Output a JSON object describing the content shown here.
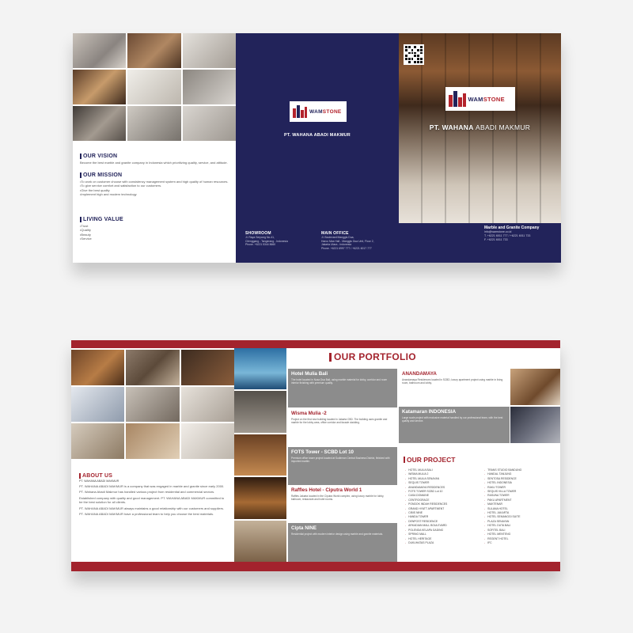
{
  "top_spread": {
    "left_panel": {
      "vision": {
        "heading": "OUR VISION",
        "text": "Become the best marble and granite company in Indonesia which prioritizing quality, service, and attitude."
      },
      "mission": {
        "heading": "OUR MISSION",
        "items": [
          "•To work on customer choose with consistency management system and high quality of human resources.",
          "•To give service comfort and satisfaction to our customers.",
          "•Give the best quality",
          "•Implement high and modern technology"
        ]
      },
      "values": {
        "heading": "LIVING VALUE",
        "items": [
          "•Trust",
          "•Quality",
          "•Beauty",
          "•Service"
        ]
      }
    },
    "middle_panel": {
      "logo_wam": "WAM",
      "logo_stone": "STONE",
      "company": "PT. WAHANA ABADI MAKMUR",
      "showroom": {
        "title": "SHOWROOM",
        "lines": [
          "Jl. Raya Serpong No.41,",
          "Cilenggang - Tangerang - Indonesia",
          "Phone. +6221 5344 8660"
        ]
      },
      "main_office": {
        "title": "MAIN OFFICE",
        "lines": [
          "Jl. Boulevard Manggis Dua,",
          "Harco Mas Hall - Manggis Dua Unit, Floor 2,",
          "Jakarta Utara - Indonesia",
          "Phone. +6221 6997 777 / +6221 6017 777"
        ]
      }
    },
    "cover": {
      "logo_wam": "WAM",
      "logo_stone": "STONE",
      "company_prefix": "PT. WAHANA ",
      "company_suffix": "ABADI MAKMUR",
      "tagline": "Marble and Granite Company",
      "contacts": [
        "info@wamstone.co.id",
        "T. +6221 6011 777 / +6221 6011 733",
        "F. +6221 6011 733"
      ]
    }
  },
  "bottom_spread": {
    "about": {
      "heading": "ABOUT US",
      "subheading": "PT. WAHANA ABADI MAKMUR",
      "paragraphs": [
        "PT. WAHANA ABADI MAKMUR is a company that was engaged in marble and granite since early 2000.",
        "PT. Wahana Abadi Makmur has handled various project from residential and commercial sectors.",
        "Established company with quality and good management. PT. WAHANA ABADI MAKMUR committed to be the best solution for all clients.",
        "PT. WAHANA ABADI MAKMUR always maintains a good relationship with our customers and suppliers.",
        "PT. WAHANA ABADI MAKMUR have a professional team to help you choose the best materials."
      ]
    },
    "portfolio_title": "OUR PORTFOLIO",
    "portfolio_cards": [
      {
        "title": "Hotel Mulia Bali",
        "text": "The hotel located in Nusa Dua Bali, using marble material for lobby, corridor and room interior finishing with premium quality."
      },
      {
        "title": "Wisma Mulia -2",
        "text": "Project on the first new building located in Jakarta CBD. The building uses granite and marble for the lobby area, office corridor and facade cladding."
      },
      {
        "title": "FOTS Tower - SCBD Lot 10",
        "text": "Premium office tower project located at Sudirman Central Business District, finished with imported marble."
      },
      {
        "title": "Raffles Hotel - Ciputra World 1",
        "text": "Raffles Jakarta located in the Ciputra World complex, using luxury marble for lobby, ballroom, restaurant and hotel rooms."
      },
      {
        "title": "Cipta NINE",
        "text": "Residential project with modern interior design using marble and granite materials."
      }
    ],
    "right_cards": [
      {
        "title": "ANANDAMAYA",
        "text": "Anandamaya Residences located in SCBD, luxury apartment project using marble in living room, bathroom and lobby."
      },
      {
        "title": "Katamaran INDONESIA",
        "text": "Large scale project with exclusive material handled by our professional team, with the best quality and service."
      }
    ],
    "project_title": "OUR PROJECT",
    "projects_col1": [
      "HOTEL MULIA BALI",
      "WISMA MULIA 2",
      "HOTEL MULIA SENAYAN",
      "SEQUIS TOWER",
      "ANANDAMAYA RESIDENCES",
      "FOTS TOWER SCBD Lot 10",
      "CASA DOMAINE",
      "CENTROGRACE",
      "PONDOK INDAH RESIDENCES",
      "GRAND HYATT APARTMENT",
      "CIBIS NINE",
      "HANDA TOWER",
      "DENPOST RESIDENCE",
      "ARKADIAN MALL BOULEVARD",
      "POLENDA KELAPA GADING",
      "SPRING MALL",
      "HOTEL HERITAGE",
      "DUKUHATAS PLAZA"
    ],
    "projects_col2": [
      "TRANS STUDIO BANDUNG",
      "HANDAL TANJUNG",
      "SENTOSA RESIDENCE",
      "HOTEL INDONESIA",
      "RAKU TOWER",
      "SEQUIS VILLA TOWER",
      "RASUNA TOWER",
      "PAKU APARTMENT",
      "MAKTENAR",
      "SULANA HOTEL",
      "HOTEL JAKARTA",
      "HOTEL SEMANGGI SUITE",
      "PLAZA SENAYAN",
      "HOTEL DUTA BALI",
      "SOFITEL BALI",
      "HOTEL MENTENG",
      "REGENT HOTEL",
      "IFC"
    ]
  }
}
